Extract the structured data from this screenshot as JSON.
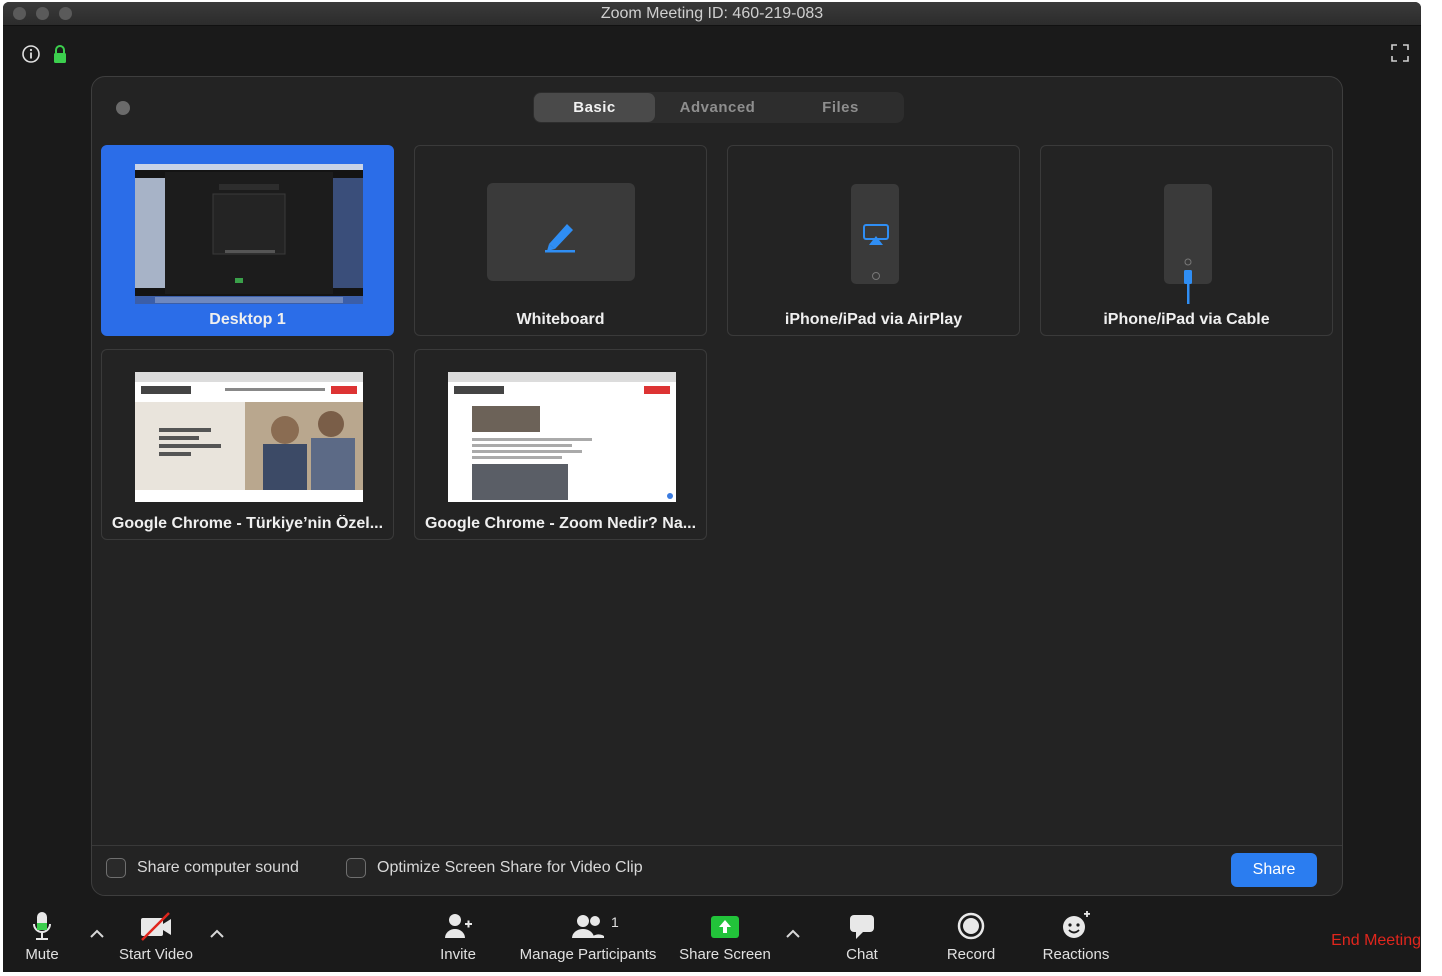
{
  "window": {
    "title": "Zoom Meeting ID: 460-219-083"
  },
  "header": {
    "info_icon": "info-icon",
    "lock_icon": "lock-icon",
    "fullscreen_icon": "fullscreen-icon"
  },
  "dialog": {
    "tabs": [
      {
        "label": "Basic",
        "active": true
      },
      {
        "label": "Advanced",
        "active": false
      },
      {
        "label": "Files",
        "active": false
      }
    ],
    "tiles": [
      {
        "label": "Desktop 1",
        "selected": true
      },
      {
        "label": "Whiteboard",
        "selected": false
      },
      {
        "label": "iPhone/iPad via AirPlay",
        "selected": false
      },
      {
        "label": "iPhone/iPad via Cable",
        "selected": false
      },
      {
        "label": "Google Chrome - Türkiye’nin Özel...",
        "selected": false
      },
      {
        "label": "Google Chrome - Zoom Nedir? Na...",
        "selected": false
      }
    ],
    "options": [
      {
        "label": "Share computer sound",
        "checked": false
      },
      {
        "label": "Optimize Screen Share for Video Clip",
        "checked": false
      }
    ],
    "share_label": "Share"
  },
  "toolbar": {
    "mute": "Mute",
    "start_video": "Start Video",
    "invite": "Invite",
    "manage_participants": "Manage Participants",
    "participant_count": "1",
    "share_screen": "Share Screen",
    "chat": "Chat",
    "record": "Record",
    "reactions": "Reactions",
    "end_meeting": "End Meeting"
  },
  "colors": {
    "accent": "#2b6de8",
    "share_green": "#22c33a",
    "end_red": "#e0261d",
    "lock_green": "#3ccf4e"
  }
}
